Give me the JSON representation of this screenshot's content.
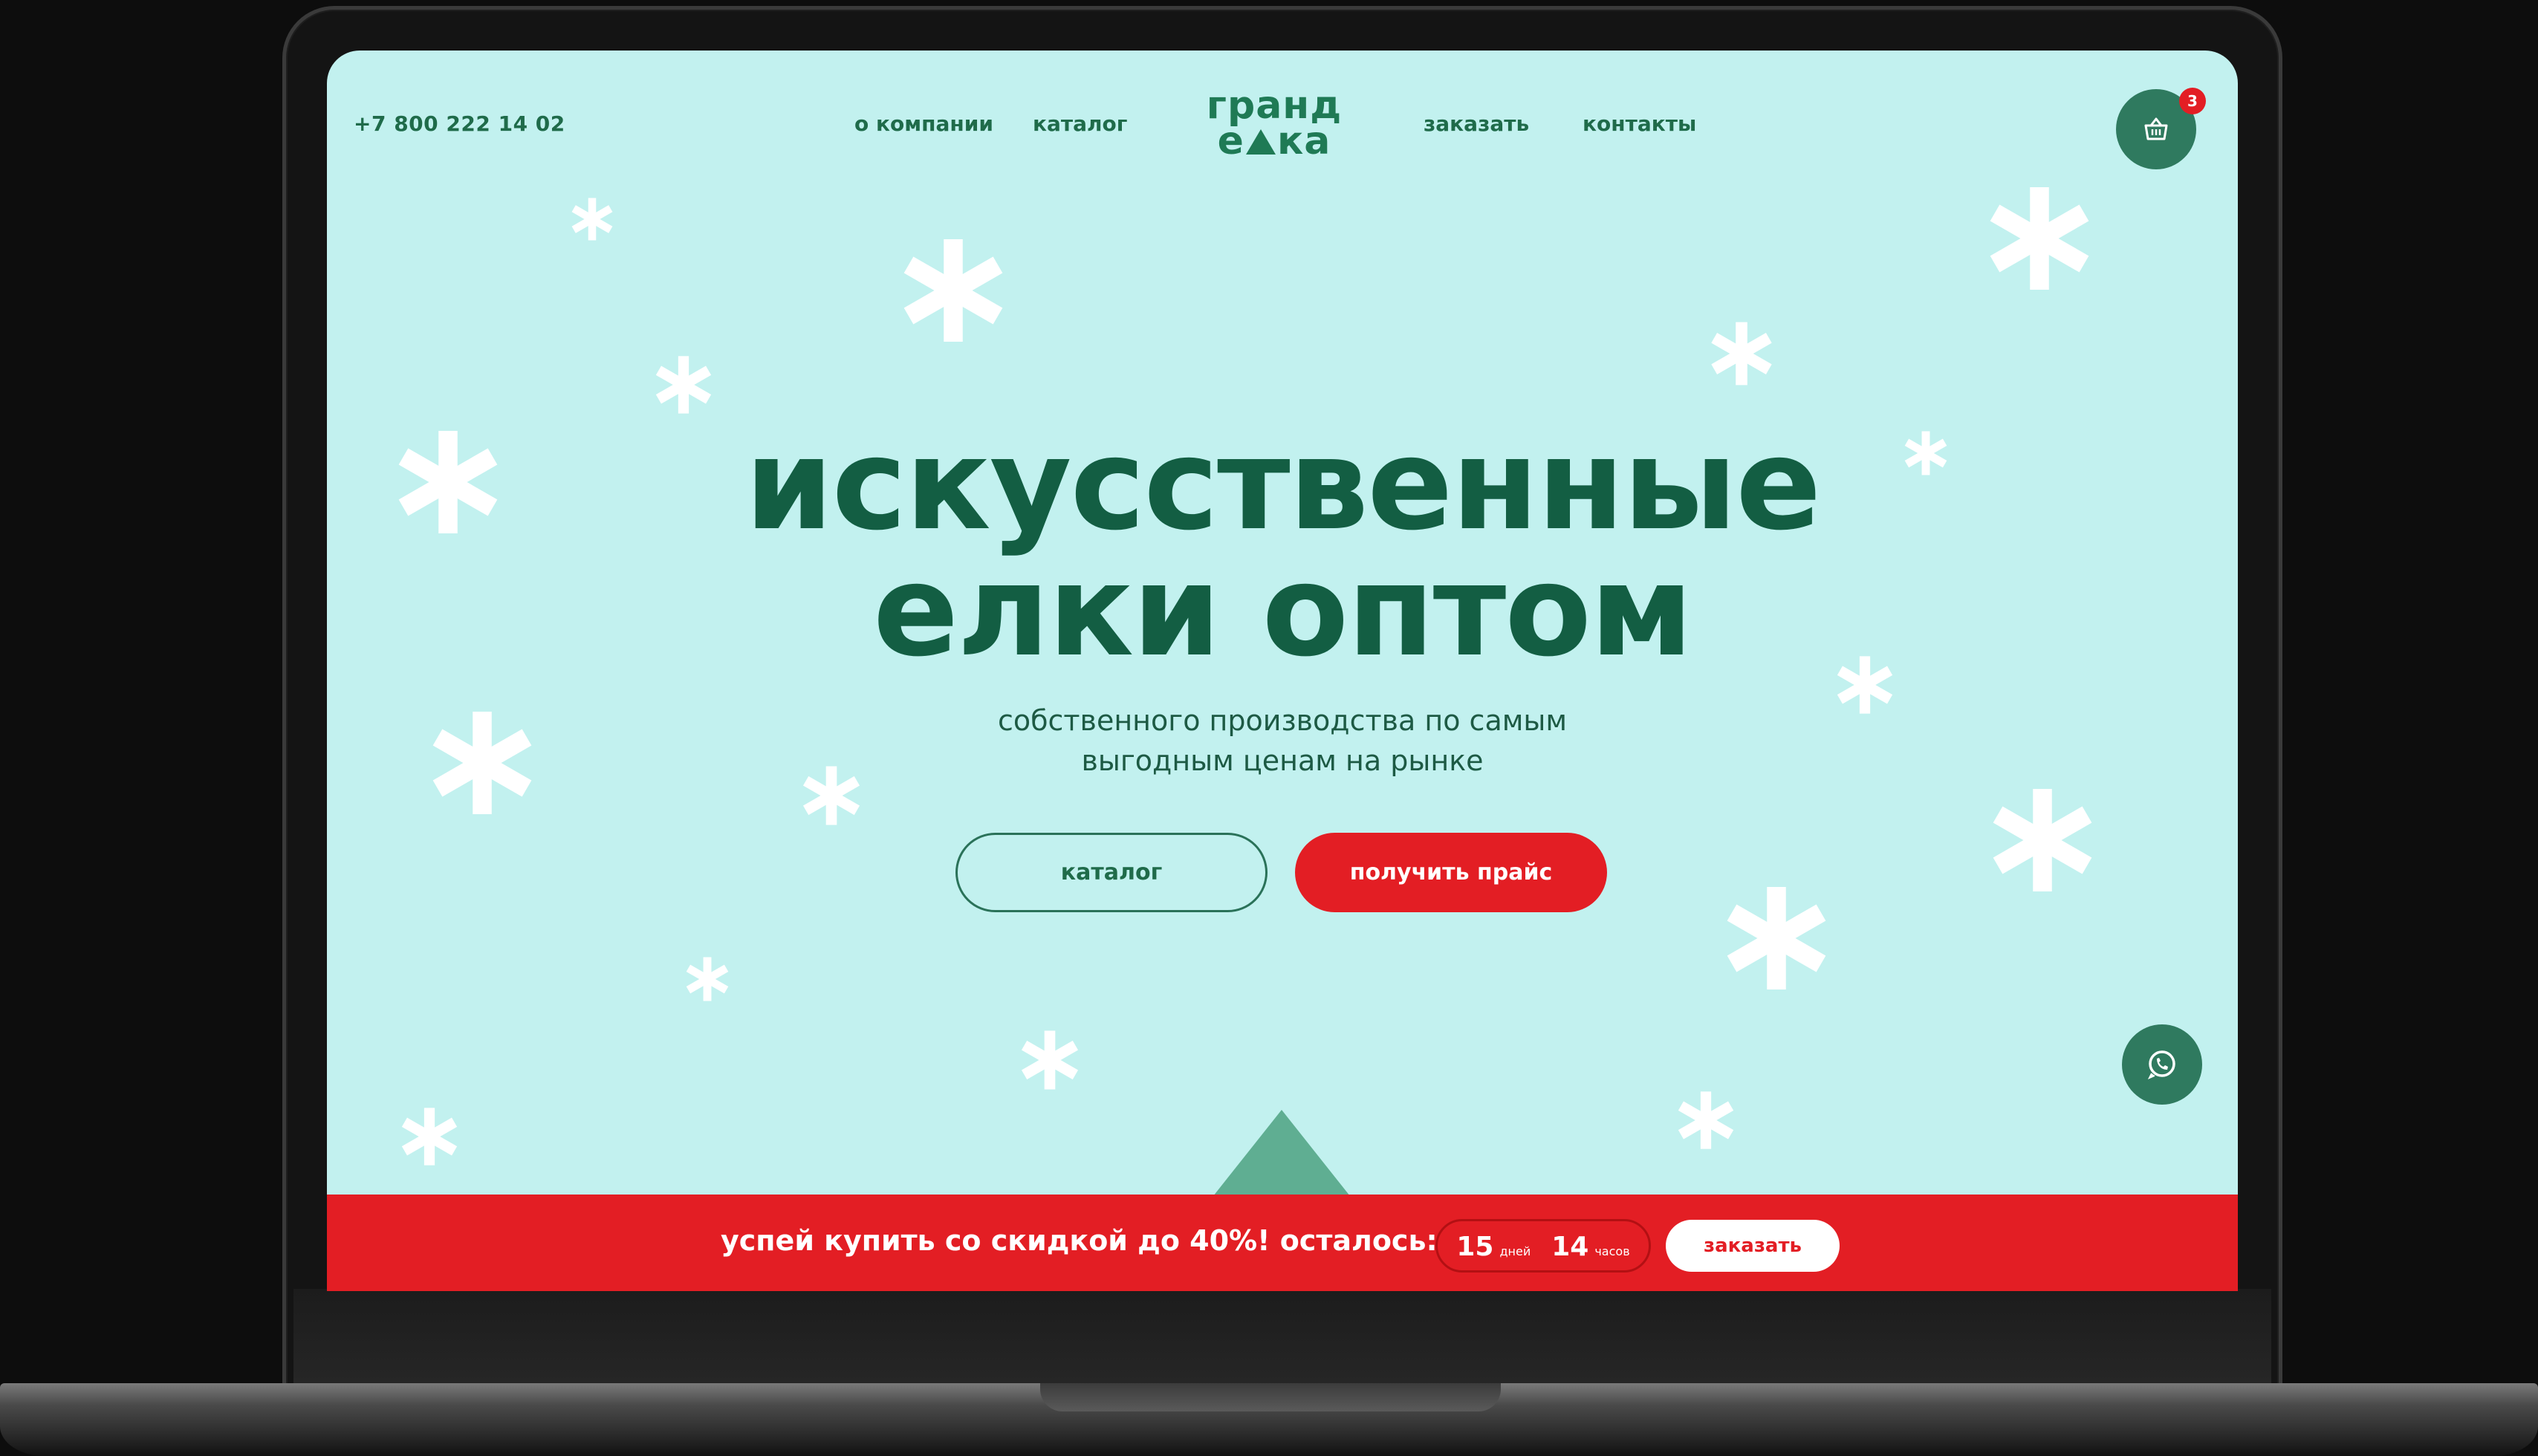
{
  "header": {
    "phone": "+7 800 222 14 02",
    "nav": [
      "о компании",
      "каталог",
      "заказать",
      "контакты"
    ],
    "logo_line1": "гранд",
    "logo_line2a": "е",
    "logo_line2b": "ка",
    "cart_count": "3"
  },
  "hero": {
    "title_line1": "искусственные",
    "title_line2": "елки оптом",
    "subtitle_line1": "собственного производства по самым",
    "subtitle_line2": "выгодным ценам на рынке",
    "btn_catalog": "каталог",
    "btn_price": "получить прайс"
  },
  "promo": {
    "text": "успей купить со скидкой до 40%! осталось:",
    "days_value": "15",
    "days_unit": "дней",
    "hours_value": "14",
    "hours_unit": "часов",
    "button": "заказать"
  },
  "colors": {
    "background": "#c2f1ef",
    "brand_green": "#135e43",
    "accent_red": "#e31e24"
  },
  "icons": [
    "snowflake-icon",
    "tree-logo-icon",
    "basket-icon",
    "whatsapp-icon"
  ]
}
